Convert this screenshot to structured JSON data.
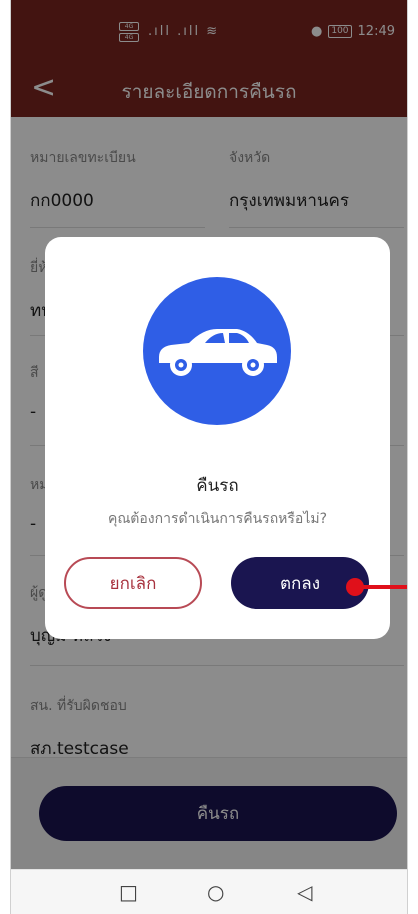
{
  "status_bar": {
    "sim1": "4G",
    "sim2": "4G",
    "signal_icons": ".ıll .ıll ≋",
    "battery": "100",
    "time": "12:49"
  },
  "app_bar": {
    "title": "รายละเอียดการคืนรถ",
    "back_glyph": "<"
  },
  "fields": {
    "plate_label": "หมายเลขทะเบียน",
    "plate_value": "กก0000",
    "province_label": "จังหวัด",
    "province_value": "กรุงเทพมหานคร",
    "brand_label_partial": "ยี่ห้",
    "brand_value_partial": "ทบ",
    "color_label_partial": "สี",
    "color_value": "-",
    "note_label_partial": "หม",
    "note_value": "-",
    "responsible_label_partial": "ผู้ดู",
    "responsible_value_partial": "บุญม หลวง",
    "station_label": "สน. ที่รับผิดชอบ",
    "station_value": "สภ.testcase"
  },
  "bottom_button": {
    "label": "คืนรถ"
  },
  "nav": {
    "back": "◁",
    "home": "○",
    "recent": "□"
  },
  "dialog": {
    "title": "คืนรถ",
    "message": "คุณต้องการดำเนินการคืนรถหรือไม่?",
    "cancel_label": "ยกเลิก",
    "confirm_label": "ตกลง",
    "icon": "car-icon",
    "icon_color": "#2f5ee6"
  },
  "colors": {
    "header": "#7a2520",
    "primary_button": "#1a1550",
    "cancel_border": "#b84a55",
    "pointer": "#e0101a"
  }
}
